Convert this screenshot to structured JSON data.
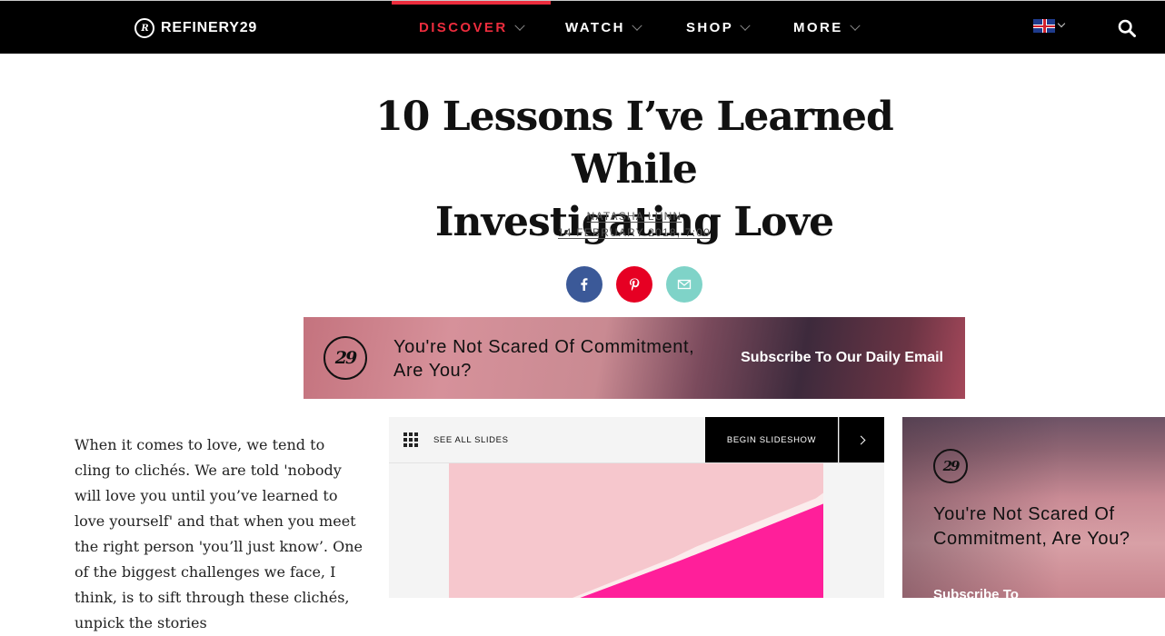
{
  "nav": {
    "brand": "REFINERY29",
    "brand_mark": "R29",
    "items": [
      {
        "label": "DISCOVER",
        "active": true
      },
      {
        "label": "WATCH",
        "active": false
      },
      {
        "label": "SHOP",
        "active": false
      },
      {
        "label": "MORE",
        "active": false
      }
    ],
    "region_flag": "uk-flag-icon",
    "search_icon": "search-icon",
    "accent_color": "#ec2c3d"
  },
  "article": {
    "title_line1": "10 Lessons I’ve Learned While",
    "title_line2": "Investigating Love",
    "author": "NATASHA LUNN",
    "date": "14 FEBRUARY 2018, 7:00",
    "body": "When it comes to love, we tend to cling to clichés. We are told 'nobody will love you until you’ve learned to love yourself' and that when you meet the right person 'you’ll just know’. One of the biggest challenges we face, I think, is to sift through these clichés, unpick the stories"
  },
  "share": [
    {
      "name": "facebook",
      "color": "#3b5998"
    },
    {
      "name": "pinterest",
      "color": "#e60023"
    },
    {
      "name": "email",
      "color": "#7fd3c8"
    }
  ],
  "promo": {
    "logo": "R29",
    "title": "You're Not Scared Of Commitment, Are You?",
    "cta": "Subscribe To Our Daily Email"
  },
  "slideshow": {
    "see_all": "SEE ALL SLIDES",
    "begin": "BEGIN SLIDESHOW"
  },
  "side_ad": {
    "logo": "R29",
    "title": "You're Not Scared Of Commitment, Are You?",
    "cta": "Subscribe To"
  }
}
